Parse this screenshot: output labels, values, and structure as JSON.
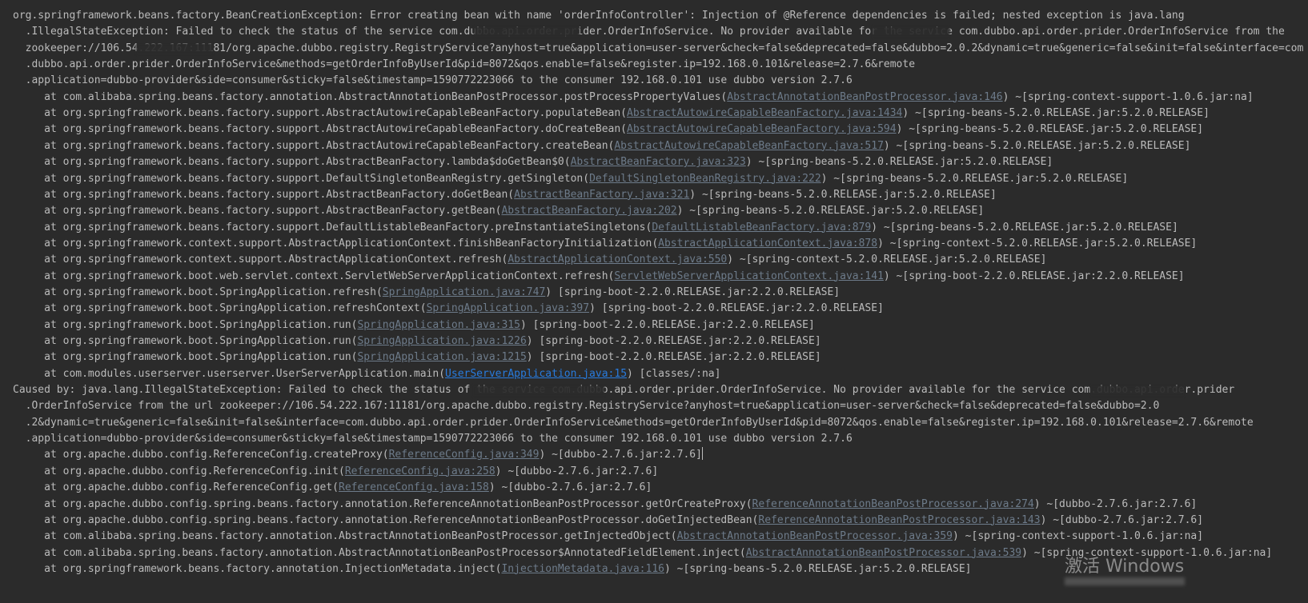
{
  "console": {
    "lines": [
      [
        {
          "t": "org.springframework.beans.factory.BeanCreationException: Error creating bean with name 'orderInfoController': Injection of @Reference dependencies is failed; nested exception is java.lang"
        }
      ],
      [
        {
          "t": "  .IllegalStateException: Failed to check the status of the service com.dubbo.api.order.prider.OrderInfoService. No provider available for the service com.dubbo.api.order.prider.OrderInfoService from the"
        }
      ],
      [
        {
          "t": "  zookeeper://106.54.222.167:11181/org.apache.dubbo.registry.RegistryService?anyhost=true&application=user-server&check=false&deprecated=false&dubbo=2.0.2&dynamic=true&generic=false&init=false&interface=com"
        }
      ],
      [
        {
          "t": "  .dubbo.api.order.prider.OrderInfoService&methods=getOrderInfoByUserId&pid=8072&qos.enable=false&register.ip=192.168.0.101&release=2.7.6&remote"
        }
      ],
      [
        {
          "t": "  .application=dubbo-provider&side=consumer&sticky=false&timestamp=1590772223066 to the consumer 192.168.0.101 use dubbo version 2.7.6"
        }
      ],
      [
        {
          "t": "     at com.alibaba.spring.beans.factory.annotation.AbstractAnnotationBeanPostProcessor.postProcessPropertyValues("
        },
        {
          "l": "AbstractAnnotationBeanPostProcessor.java:146"
        },
        {
          "t": ") ~[spring-context-support-1.0.6.jar:na]"
        }
      ],
      [
        {
          "t": "     at org.springframework.beans.factory.support.AbstractAutowireCapableBeanFactory.populateBean("
        },
        {
          "l": "AbstractAutowireCapableBeanFactory.java:1434"
        },
        {
          "t": ") ~[spring-beans-5.2.0.RELEASE.jar:5.2.0.RELEASE]"
        }
      ],
      [
        {
          "t": "     at org.springframework.beans.factory.support.AbstractAutowireCapableBeanFactory.doCreateBean("
        },
        {
          "l": "AbstractAutowireCapableBeanFactory.java:594"
        },
        {
          "t": ") ~[spring-beans-5.2.0.RELEASE.jar:5.2.0.RELEASE]"
        }
      ],
      [
        {
          "t": "     at org.springframework.beans.factory.support.AbstractAutowireCapableBeanFactory.createBean("
        },
        {
          "l": "AbstractAutowireCapableBeanFactory.java:517"
        },
        {
          "t": ") ~[spring-beans-5.2.0.RELEASE.jar:5.2.0.RELEASE]"
        }
      ],
      [
        {
          "t": "     at org.springframework.beans.factory.support.AbstractBeanFactory.lambda$doGetBean$0("
        },
        {
          "l": "AbstractBeanFactory.java:323"
        },
        {
          "t": ") ~[spring-beans-5.2.0.RELEASE.jar:5.2.0.RELEASE]"
        }
      ],
      [
        {
          "t": "     at org.springframework.beans.factory.support.DefaultSingletonBeanRegistry.getSingleton("
        },
        {
          "l": "DefaultSingletonBeanRegistry.java:222"
        },
        {
          "t": ") ~[spring-beans-5.2.0.RELEASE.jar:5.2.0.RELEASE]"
        }
      ],
      [
        {
          "t": "     at org.springframework.beans.factory.support.AbstractBeanFactory.doGetBean("
        },
        {
          "l": "AbstractBeanFactory.java:321"
        },
        {
          "t": ") ~[spring-beans-5.2.0.RELEASE.jar:5.2.0.RELEASE]"
        }
      ],
      [
        {
          "t": "     at org.springframework.beans.factory.support.AbstractBeanFactory.getBean("
        },
        {
          "l": "AbstractBeanFactory.java:202"
        },
        {
          "t": ") ~[spring-beans-5.2.0.RELEASE.jar:5.2.0.RELEASE]"
        }
      ],
      [
        {
          "t": "     at org.springframework.beans.factory.support.DefaultListableBeanFactory.preInstantiateSingletons("
        },
        {
          "l": "DefaultListableBeanFactory.java:879"
        },
        {
          "t": ") ~[spring-beans-5.2.0.RELEASE.jar:5.2.0.RELEASE]"
        }
      ],
      [
        {
          "t": "     at org.springframework.context.support.AbstractApplicationContext.finishBeanFactoryInitialization("
        },
        {
          "l": "AbstractApplicationContext.java:878"
        },
        {
          "t": ") ~[spring-context-5.2.0.RELEASE.jar:5.2.0.RELEASE]"
        }
      ],
      [
        {
          "t": "     at org.springframework.context.support.AbstractApplicationContext.refresh("
        },
        {
          "l": "AbstractApplicationContext.java:550"
        },
        {
          "t": ") ~[spring-context-5.2.0.RELEASE.jar:5.2.0.RELEASE]"
        }
      ],
      [
        {
          "t": "     at org.springframework.boot.web.servlet.context.ServletWebServerApplicationContext.refresh("
        },
        {
          "l": "ServletWebServerApplicationContext.java:141"
        },
        {
          "t": ") ~[spring-boot-2.2.0.RELEASE.jar:2.2.0.RELEASE]"
        }
      ],
      [
        {
          "t": "     at org.springframework.boot.SpringApplication.refresh("
        },
        {
          "l": "SpringApplication.java:747"
        },
        {
          "t": ") [spring-boot-2.2.0.RELEASE.jar:2.2.0.RELEASE]"
        }
      ],
      [
        {
          "t": "     at org.springframework.boot.SpringApplication.refreshContext("
        },
        {
          "l": "SpringApplication.java:397"
        },
        {
          "t": ") [spring-boot-2.2.0.RELEASE.jar:2.2.0.RELEASE]"
        }
      ],
      [
        {
          "t": "     at org.springframework.boot.SpringApplication.run("
        },
        {
          "l": "SpringApplication.java:315"
        },
        {
          "t": ") [spring-boot-2.2.0.RELEASE.jar:2.2.0.RELEASE]"
        }
      ],
      [
        {
          "t": "     at org.springframework.boot.SpringApplication.run("
        },
        {
          "l": "SpringApplication.java:1226"
        },
        {
          "t": ") [spring-boot-2.2.0.RELEASE.jar:2.2.0.RELEASE]"
        }
      ],
      [
        {
          "t": "     at org.springframework.boot.SpringApplication.run("
        },
        {
          "l": "SpringApplication.java:1215"
        },
        {
          "t": ") [spring-boot-2.2.0.RELEASE.jar:2.2.0.RELEASE]"
        }
      ],
      [
        {
          "t": "     at com.modules.userserver.userserver.UserServerApplication.main("
        },
        {
          "l": "UserServerApplication.java:15",
          "active": true
        },
        {
          "t": ") [classes/:na]"
        }
      ],
      [
        {
          "t": "Caused by: java.lang.IllegalStateException: Failed to check the status of the service com.dubbo.api.order.prider.OrderInfoService. No provider available for the service com.dubbo.api.order.prider"
        }
      ],
      [
        {
          "t": "  .OrderInfoService from the url zookeeper://106.54.222.167:11181/org.apache.dubbo.registry.RegistryService?anyhost=true&application=user-server&check=false&deprecated=false&dubbo=2.0"
        }
      ],
      [
        {
          "t": "  .2&dynamic=true&generic=false&init=false&interface=com.dubbo.api.order.prider.OrderInfoService&methods=getOrderInfoByUserId&pid=8072&qos.enable=false&register.ip=192.168.0.101&release=2.7.6&remote"
        }
      ],
      [
        {
          "t": "  .application=dubbo-provider&side=consumer&sticky=false&timestamp=1590772223066 to the consumer 192.168.0.101 use dubbo version 2.7.6"
        }
      ],
      [
        {
          "t": "     at org.apache.dubbo.config.ReferenceConfig.createProxy("
        },
        {
          "l": "ReferenceConfig.java:349"
        },
        {
          "t": ") ~[dubbo-2.7.6.jar:2.7.6]"
        },
        {
          "cursor": true
        }
      ],
      [
        {
          "t": "     at org.apache.dubbo.config.ReferenceConfig.init("
        },
        {
          "l": "ReferenceConfig.java:258"
        },
        {
          "t": ") ~[dubbo-2.7.6.jar:2.7.6]"
        }
      ],
      [
        {
          "t": "     at org.apache.dubbo.config.ReferenceConfig.get("
        },
        {
          "l": "ReferenceConfig.java:158"
        },
        {
          "t": ") ~[dubbo-2.7.6.jar:2.7.6]"
        }
      ],
      [
        {
          "t": "     at org.apache.dubbo.config.spring.beans.factory.annotation.ReferenceAnnotationBeanPostProcessor.getOrCreateProxy("
        },
        {
          "l": "ReferenceAnnotationBeanPostProcessor.java:274"
        },
        {
          "t": ") ~[dubbo-2.7.6.jar:2.7.6]"
        }
      ],
      [
        {
          "t": "     at org.apache.dubbo.config.spring.beans.factory.annotation.ReferenceAnnotationBeanPostProcessor.doGetInjectedBean("
        },
        {
          "l": "ReferenceAnnotationBeanPostProcessor.java:143"
        },
        {
          "t": ") ~[dubbo-2.7.6.jar:2.7.6]"
        }
      ],
      [
        {
          "t": "     at com.alibaba.spring.beans.factory.annotation.AbstractAnnotationBeanPostProcessor.getInjectedObject("
        },
        {
          "l": "AbstractAnnotationBeanPostProcessor.java:359"
        },
        {
          "t": ") ~[spring-context-support-1.0.6.jar:na]"
        }
      ],
      [
        {
          "t": "     at com.alibaba.spring.beans.factory.annotation.AbstractAnnotationBeanPostProcessor$AnnotatedFieldElement.inject("
        },
        {
          "l": "AbstractAnnotationBeanPostProcessor.java:539"
        },
        {
          "t": ") ~[spring-context-support-1.0.6.jar:na]"
        }
      ],
      [
        {
          "t": "     at org.springframework.beans.factory.annotation.InjectionMetadata.inject("
        },
        {
          "l": "InjectionMetadata.java:116"
        },
        {
          "t": ") ~[spring-beans-5.2.0.RELEASE.jar:5.2.0.RELEASE]"
        }
      ]
    ]
  },
  "watermark": {
    "text": "激活 Windows"
  },
  "colors": {
    "background": "#2b2b2b",
    "text": "#bbbbbb",
    "link": "#6d7b8a",
    "link_active": "#287bde"
  }
}
